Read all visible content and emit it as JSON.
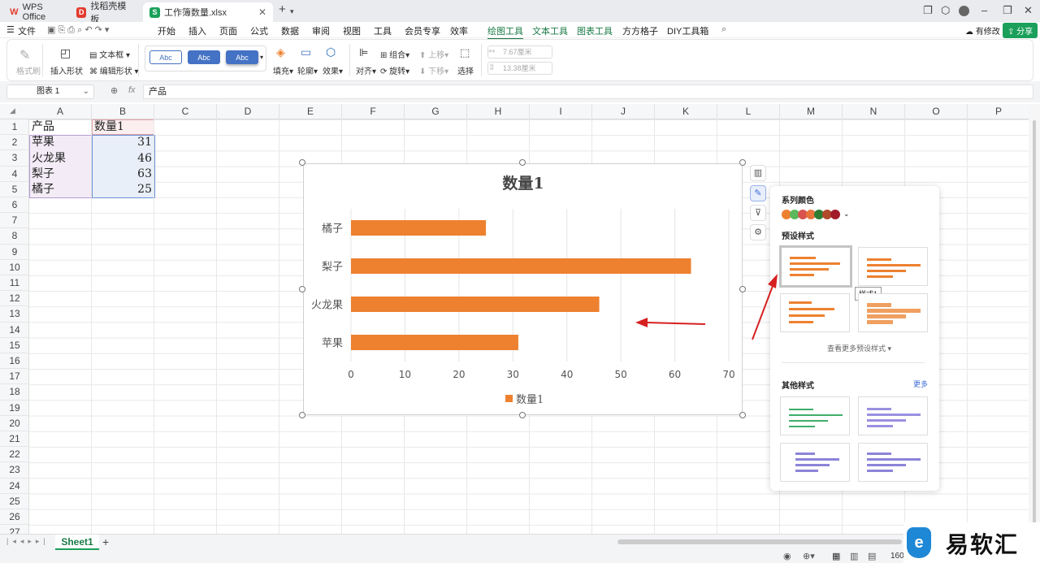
{
  "tabs": [
    {
      "label": "WPS Office",
      "icon": "wps-logo-icon",
      "color": "#e23b2e"
    },
    {
      "label": "找稻壳模板",
      "icon": "docer-icon",
      "color": "#e23b2e"
    },
    {
      "label": "工作簿数量.xlsx",
      "icon": "sheet-file-icon",
      "color": "#1aa05a"
    }
  ],
  "menu": {
    "file": "文件",
    "items": [
      "开始",
      "插入",
      "页面",
      "公式",
      "数据",
      "审阅",
      "视图",
      "工具",
      "会员专享",
      "效率"
    ],
    "context": [
      "绘图工具",
      "文本工具",
      "图表工具",
      "方方格子",
      "DIY工具箱"
    ],
    "selected": "绘图工具",
    "modify": "有修改",
    "share": "分享"
  },
  "ribbon": {
    "format_painter": "格式刷",
    "insert_shape": "插入形状",
    "textbox": "文本框",
    "edit_shape": "编辑形状",
    "style_samples": [
      "Abc",
      "Abc",
      "Abc"
    ],
    "fill": "填充",
    "outline": "轮廓",
    "effect": "效果",
    "align": "对齐",
    "group": "组合",
    "rotate": "旋转",
    "bring_forward": "上移",
    "send_backward": "下移",
    "select": "选择",
    "width": "7.67厘米",
    "height": "13.38厘米"
  },
  "formula": {
    "name_box": "图表 1",
    "fx": "fx",
    "content": "产品"
  },
  "columns": [
    "A",
    "B",
    "C",
    "D",
    "E",
    "F",
    "G",
    "H",
    "I",
    "J",
    "K",
    "L",
    "M",
    "N",
    "O",
    "P"
  ],
  "rows": [
    "1",
    "2",
    "3",
    "4",
    "5",
    "6",
    "7",
    "8",
    "9",
    "10",
    "11",
    "12",
    "13",
    "14",
    "15",
    "16",
    "17",
    "18",
    "19",
    "20",
    "21",
    "22",
    "23",
    "24",
    "25",
    "26",
    "27"
  ],
  "sheet": {
    "header": [
      "产品",
      "数量1"
    ],
    "data": [
      [
        "苹果",
        "31"
      ],
      [
        "火龙果",
        "46"
      ],
      [
        "梨子",
        "63"
      ],
      [
        "橘子",
        "25"
      ]
    ]
  },
  "chart_data": {
    "type": "bar",
    "orientation": "horizontal",
    "title": "数量1",
    "categories": [
      "苹果",
      "火龙果",
      "梨子",
      "橘子"
    ],
    "series": [
      {
        "name": "数量1",
        "values": [
          31,
          46,
          63,
          25
        ]
      }
    ],
    "xlim": [
      0,
      70
    ],
    "xticks": [
      0,
      10,
      20,
      30,
      40,
      50,
      60,
      70
    ],
    "grid": true,
    "legend": "bottom",
    "color": "#ed8130"
  },
  "panel": {
    "series_color_title": "系列颜色",
    "swatches": [
      "#ed8130",
      "#e8743b",
      "#5cb85c",
      "#d9534f",
      "#b04a2a",
      "#2e7d32",
      "#a01c2a"
    ],
    "preset_title": "预设样式",
    "tooltip": "样式1",
    "more_presets": "查看更多预设样式",
    "other_title": "其他样式",
    "more": "更多"
  },
  "sheet_tabs": {
    "active": "Sheet1"
  },
  "status": {
    "zoom": "160"
  },
  "watermark": "易软汇"
}
